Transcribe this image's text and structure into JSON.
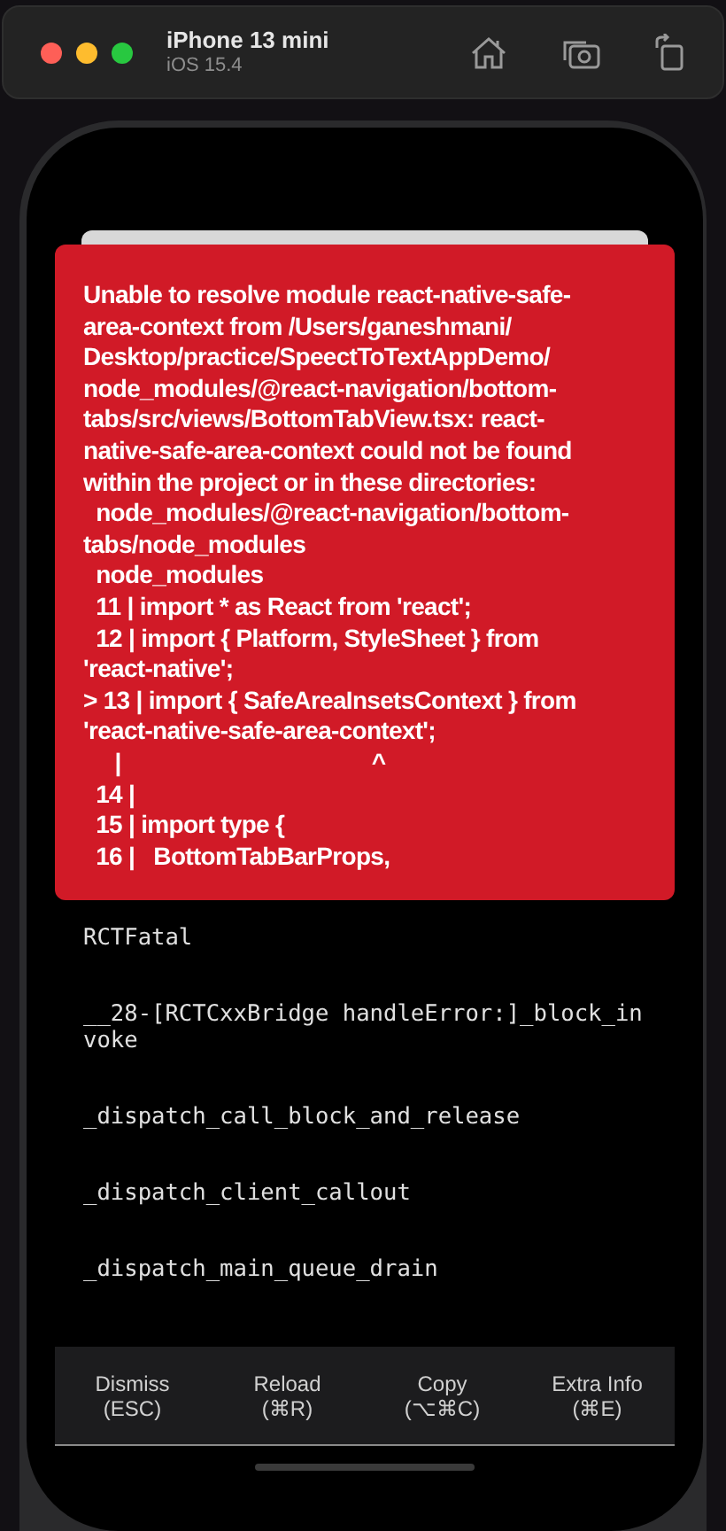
{
  "window": {
    "title": "iPhone 13 mini",
    "subtitle": "iOS 15.4"
  },
  "error": {
    "message_lines": [
      "Unable to resolve module react-native-safe-",
      "area-context from /Users/ganeshmani/",
      "Desktop/practice/SpeectToTextAppDemo/",
      "node_modules/@react-navigation/bottom-",
      "tabs/src/views/BottomTabView.tsx: react-",
      "native-safe-area-context could not be found",
      "within the project or in these directories:",
      "  node_modules/@react-navigation/bottom-",
      "tabs/node_modules",
      "  node_modules",
      "  11 | import * as React from 'react';",
      "  12 | import { Platform, StyleSheet } from",
      "'react-native';",
      "> 13 | import { SafeAreaInsetsContext } from",
      "'react-native-safe-area-context';",
      "     |                                        ^",
      "  14 |",
      "  15 | import type {",
      "  16 |   BottomTabBarProps,"
    ]
  },
  "stack_frames": [
    "RCTFatal",
    "__28-[RCTCxxBridge handleError:]_block_invoke",
    "_dispatch_call_block_and_release",
    "_dispatch_client_callout",
    "_dispatch_main_queue_drain"
  ],
  "actions": [
    {
      "label": "Dismiss",
      "shortcut": "(ESC)"
    },
    {
      "label": "Reload",
      "shortcut": "(⌘R)"
    },
    {
      "label": "Copy",
      "shortcut": "(⌥⌘C)"
    },
    {
      "label": "Extra Info",
      "shortcut": "(⌘E)"
    }
  ]
}
